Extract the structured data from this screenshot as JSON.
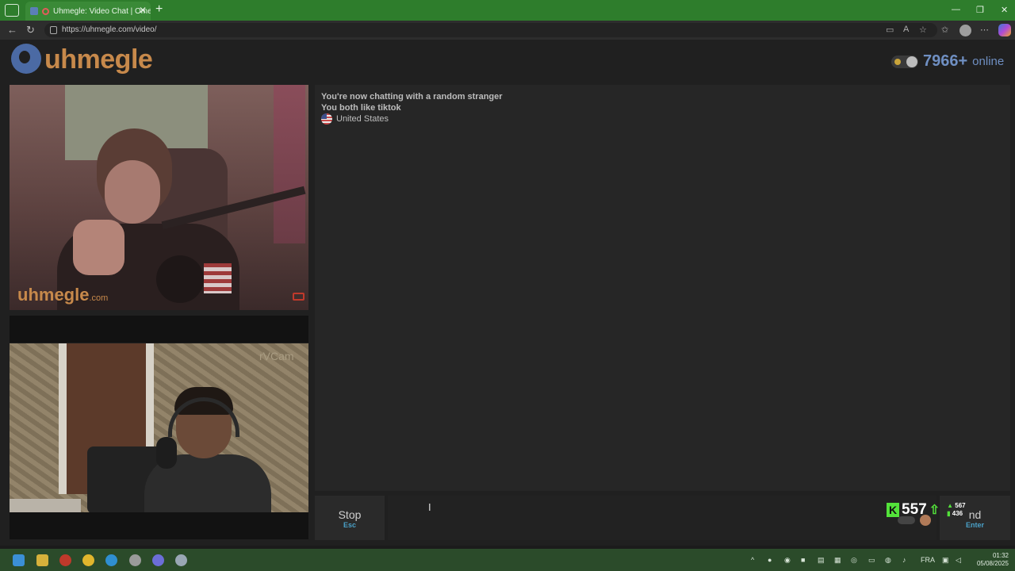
{
  "browser": {
    "tab_title": "Uhmegle: Video Chat | Ome",
    "url": "https://uhmegle.com/video/"
  },
  "site": {
    "logo_text": "uhmegle",
    "online_count": "7966+",
    "online_label": "online"
  },
  "video": {
    "watermark": "uhmegle",
    "watermark_suffix": ".com",
    "self_overlay": "rVCam"
  },
  "chat": {
    "lines": [
      "You're now chatting with a random stranger",
      "You both like tiktok"
    ],
    "country": "United States"
  },
  "controls": {
    "stop_label": "Stop",
    "stop_key": "Esc",
    "send_label": "nd",
    "send_key": "Enter",
    "message_value": ""
  },
  "stream_overlay": {
    "logo": "K",
    "viewers": "557",
    "stat_up": "567",
    "stat_down": "436"
  },
  "taskbar": {
    "language": "FRA",
    "time": "01:32",
    "date": "05/08/2025"
  }
}
